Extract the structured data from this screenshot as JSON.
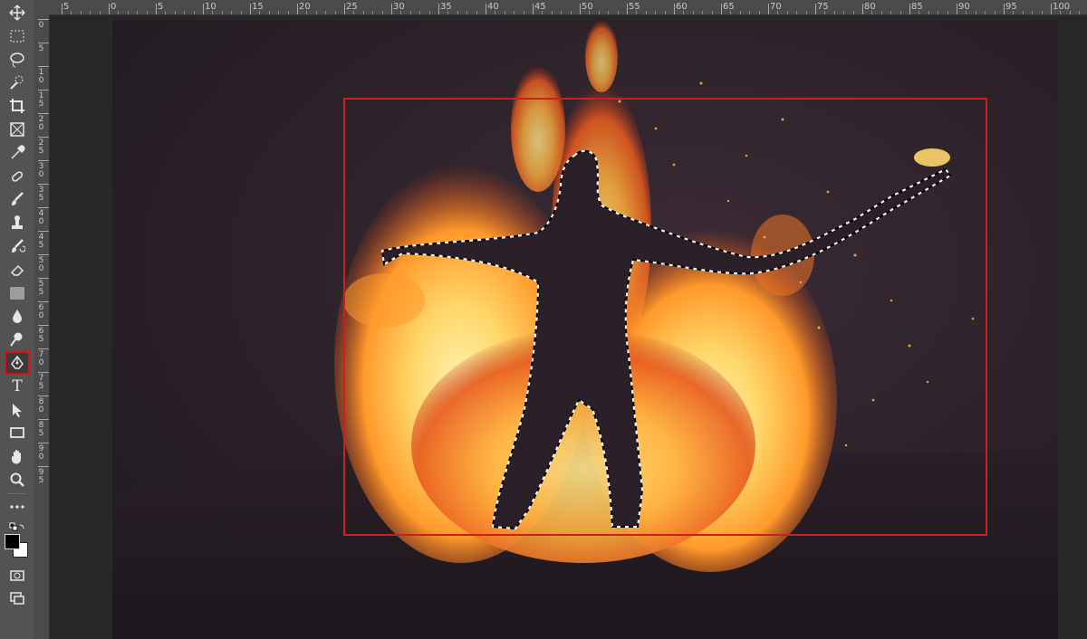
{
  "app": "Photoshop",
  "toolbar": {
    "selected_tool": "pen-tool",
    "type_tool_glyph": "T",
    "tools": [
      "move-icon",
      "marquee-icon",
      "lasso-icon",
      "quick-selection-icon",
      "crop-icon",
      "frame-icon",
      "eyedropper-icon",
      "healing-icon",
      "brush-icon",
      "clone-stamp-icon",
      "history-brush-icon",
      "eraser-icon",
      "gradient-icon",
      "blur-icon",
      "dodge-icon",
      "pen-icon",
      "type-icon",
      "path-selection-icon",
      "rectangle-icon",
      "hand-icon",
      "zoom-icon",
      "more-icon",
      "swap-colors-icon",
      "foreground-color",
      "background-color",
      "quick-mask-icon",
      "screen-mode-icon"
    ],
    "foreground_color": "#000000",
    "background_color": "#ffffff"
  },
  "rulers": {
    "top_labels": [
      "5",
      "0",
      "5",
      "10",
      "15",
      "20",
      "25",
      "30",
      "35",
      "40",
      "45",
      "50",
      "55",
      "60",
      "65",
      "70",
      "75",
      "80",
      "85",
      "90",
      "95",
      "100"
    ],
    "left_labels": [
      "0",
      "5",
      "10",
      "15",
      "20",
      "25",
      "30",
      "35",
      "40",
      "45",
      "50",
      "55",
      "60",
      "65",
      "70",
      "75",
      "80",
      "85",
      "90",
      "95"
    ]
  },
  "canvas": {
    "image": "silhouette of a man with outstretched arms in front of a large fire at night",
    "selection": "marching-ants selection around the figure silhouette",
    "highlight_box_color": "#cc1f1f",
    "fire_colors": [
      "#ffd76a",
      "#ff9a2b",
      "#e1471a"
    ]
  }
}
